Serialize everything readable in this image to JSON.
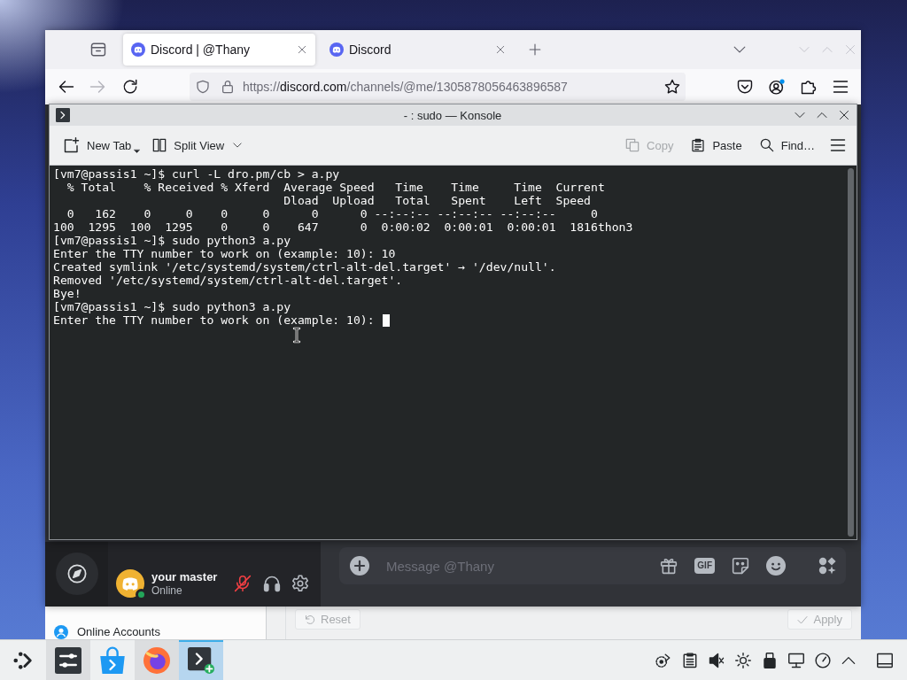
{
  "browser": {
    "tabs": [
      {
        "label": "Discord | @Thany",
        "selected": true
      },
      {
        "label": "Discord",
        "selected": false
      }
    ],
    "navigation": {
      "back_disabled": false,
      "forward_disabled": true
    },
    "address": {
      "scheme": "https://",
      "host": "discord.com",
      "path": "/channels/@me/1305878056463896587"
    }
  },
  "discord": {
    "user": {
      "name": "your master",
      "status": "Online",
      "mic_muted": true
    },
    "composer": {
      "placeholder": "Message @Thany",
      "gif_label": "GIF"
    }
  },
  "konsole": {
    "title": "- : sudo — Konsole",
    "toolbar": {
      "left": [
        {
          "label": "New Tab",
          "kind": "new-tab",
          "disabled": false
        },
        {
          "label": "Split View",
          "kind": "split-view",
          "disabled": false
        }
      ],
      "right": [
        {
          "label": "Copy",
          "kind": "copy",
          "disabled": true
        },
        {
          "label": "Paste",
          "kind": "paste",
          "disabled": false
        },
        {
          "label": "Find…",
          "kind": "find",
          "disabled": false
        }
      ]
    },
    "terminal": {
      "lines": [
        "[vm7@passis1 ~]$ curl -L dro.pm/cb > a.py",
        "  % Total    % Received % Xferd  Average Speed   Time    Time     Time  Current",
        "                                 Dload  Upload   Total   Spent    Left  Speed",
        "  0   162    0     0    0     0      0      0 --:--:-- --:--:-- --:--:--     0",
        "100  1295  100  1295    0     0    647      0  0:00:02  0:00:01  0:00:01  1816thon3",
        "[vm7@passis1 ~]$ sudo python3 a.py",
        "Enter the TTY number to work on (example: 10): 10",
        "Created symlink '/etc/systemd/system/ctrl-alt-del.target' → '/dev/null'.",
        "Removed '/etc/systemd/system/ctrl-alt-del.target'.",
        "Bye!",
        "[vm7@passis1 ~]$ sudo python3 a.py",
        "Enter the TTY number to work on (example: 10):"
      ],
      "cursor": true
    }
  },
  "settings": {
    "sidebar": [
      {
        "label": "Online Accounts",
        "kind": "accounts"
      }
    ],
    "buttons": [
      {
        "label": "Reset",
        "kind": "reset",
        "disabled": true
      },
      {
        "label": "Apply",
        "kind": "apply",
        "disabled": true
      }
    ]
  },
  "taskbar": {
    "tasks": [
      {
        "kind": "settings",
        "running": true,
        "selected": false
      },
      {
        "kind": "store",
        "running": false,
        "selected": false
      },
      {
        "kind": "browser",
        "running": true,
        "selected": false
      },
      {
        "kind": "terminal",
        "running": true,
        "selected": true
      }
    ],
    "volume_muted": true
  }
}
